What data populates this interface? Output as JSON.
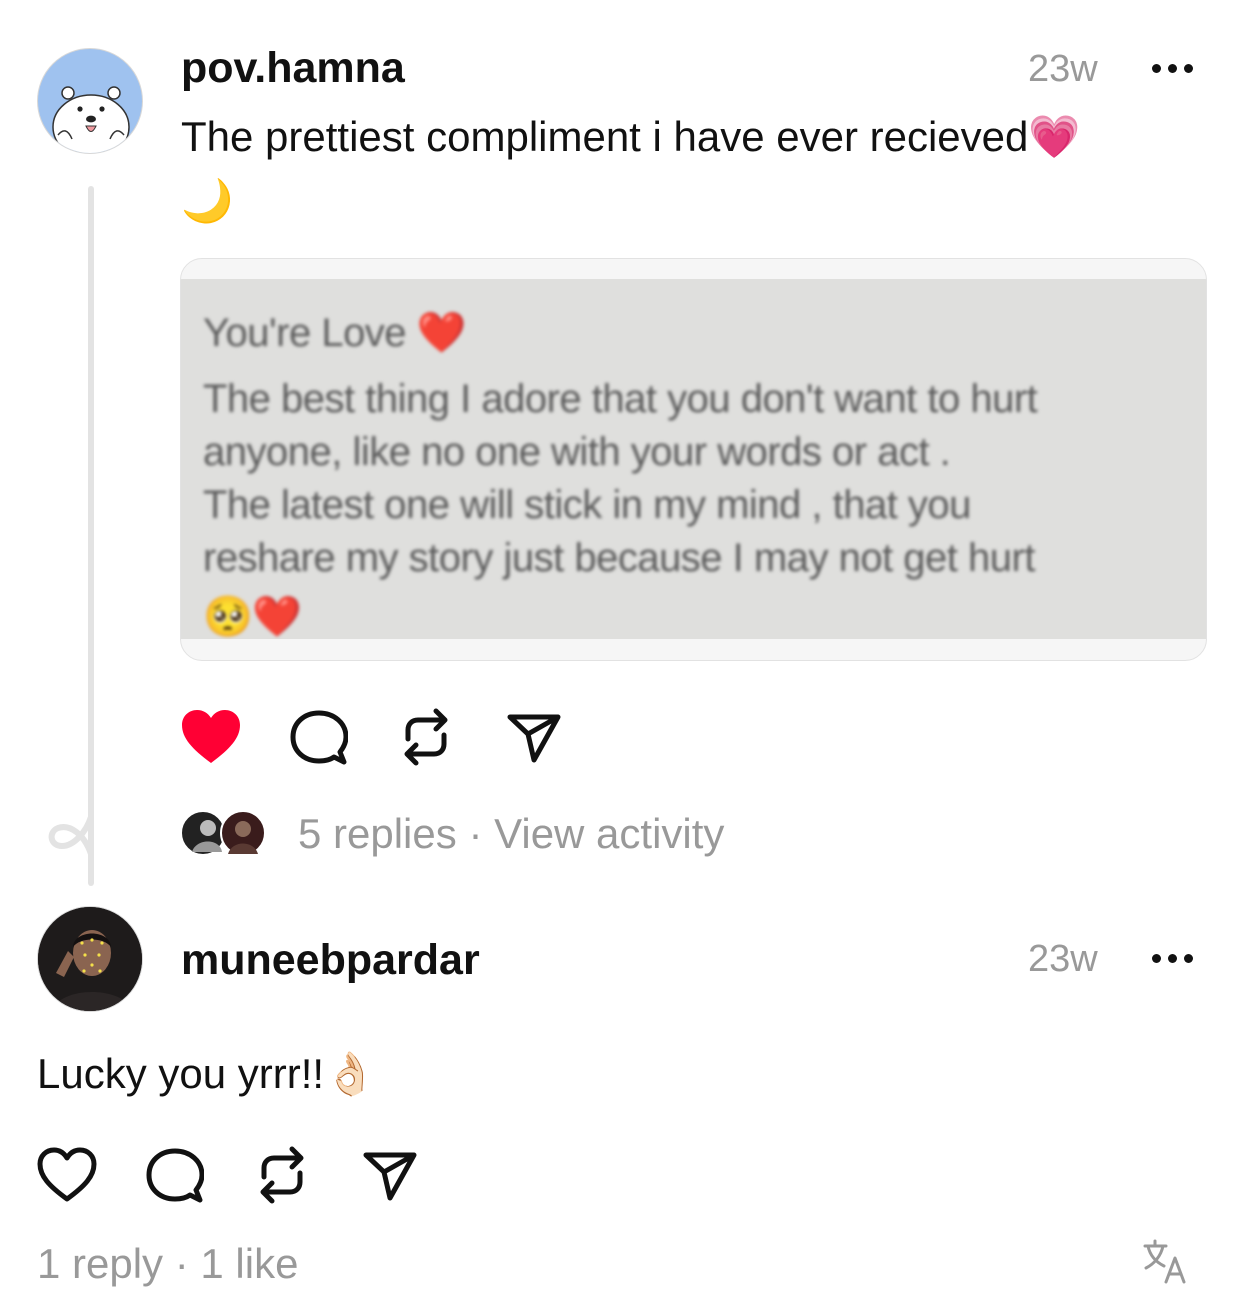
{
  "post": {
    "username": "pov.hamna",
    "time": "23w",
    "text_line1": "The prettiest compliment i have ever recieved💗",
    "text_line2": "🌙",
    "image": {
      "line1": "You're Love ❤️",
      "line2": "The best thing I adore that you don't want to hurt",
      "line3": "anyone, like no one with your words or act .",
      "line4": "The latest one will stick in my mind , that you",
      "line5": "reshare my story just because I may not get hurt",
      "line6": "🥺❤️"
    },
    "liked": true,
    "replies_text": "5 replies",
    "separator": "·",
    "view_activity": "View activity"
  },
  "reply": {
    "username": "muneebpardar",
    "time": "23w",
    "text": "Lucky you yrrr!!👌🏻",
    "liked": false,
    "stats": "1 reply · 1 like"
  },
  "icons": {
    "like": "heart-icon",
    "comment": "comment-icon",
    "repost": "repost-icon",
    "share": "send-icon",
    "more": "more-icon",
    "translate": "translate-icon"
  },
  "colors": {
    "like_active": "#ff0034",
    "muted_text": "#999999",
    "thread_line": "#e3e3e3"
  }
}
